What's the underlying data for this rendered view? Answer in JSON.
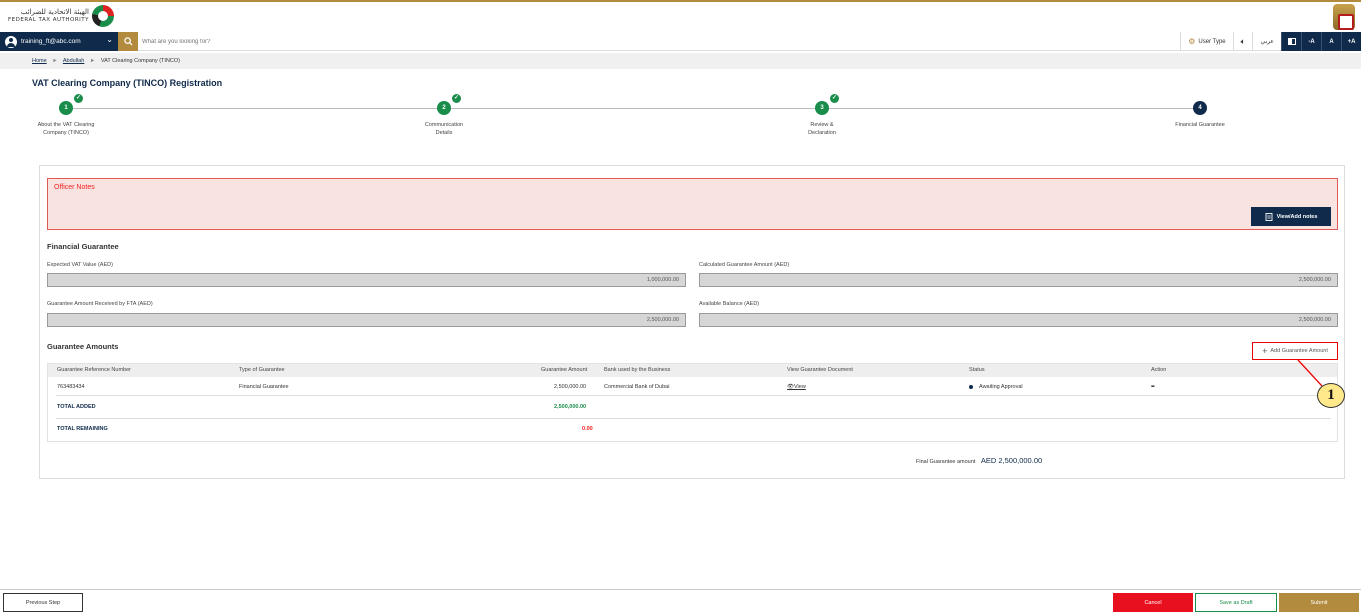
{
  "header": {
    "logo_ar": "الهيئة الاتحادية للضرائب",
    "logo_en": "FEDERAL TAX AUTHORITY"
  },
  "navbar": {
    "user_email": "training_ft@abc.com",
    "search_placeholder": "What are you looking for?",
    "user_type": "User Type",
    "language": "عربي",
    "font_minus": "-A",
    "font_normal": "A",
    "font_plus": "+A"
  },
  "breadcrumb": {
    "home": "Home",
    "sep1": "►",
    "abdullah": "Abdullah",
    "sep2": "►",
    "current": "VAT Clearing Company (TINCO)"
  },
  "page": {
    "title": "VAT Clearing Company (TINCO) Registration"
  },
  "steps": [
    {
      "number": "1",
      "label": "About the VAT Clearing Company (TINCO)",
      "status": "done"
    },
    {
      "number": "2",
      "label": "Communication Details",
      "status": "done"
    },
    {
      "number": "3",
      "label": "Review & Declaration",
      "status": "done"
    },
    {
      "number": "4",
      "label": "Financial Guarantee",
      "status": "current"
    }
  ],
  "officer_notes": {
    "title": "Officer Notes",
    "button": "View/Add notes"
  },
  "financial_guarantee": {
    "title": "Financial Guarantee",
    "expected_vat_label": "Expected VAT Value (AED)",
    "expected_vat_value": "1,000,000.00",
    "calculated_label": "Calculated Guarantee Amount (AED)",
    "calculated_value": "2,500,000.00",
    "received_label": "Guarantee Amount Received by FTA (AED)",
    "received_value": "2,500,000.00",
    "available_label": "Available Balance (AED)",
    "available_value": "2,500,000.00"
  },
  "guarantee_amounts": {
    "title": "Guarantee Amounts",
    "add_button": "Add Guarantee Amount",
    "columns": {
      "ref": "Guarantee Reference Number",
      "type": "Type of Guarantee",
      "amount": "Guarantee Amount",
      "bank": "Bank used by the Business",
      "doc": "View Guarantee Document",
      "status": "Status",
      "action": "Action"
    },
    "rows": [
      {
        "ref": "763483434",
        "type": "Financial Guarantee",
        "amount": "2,500,000.00",
        "bank": "Commercial Bank of Dubai",
        "doc": "View",
        "status": "Awaiting Approval",
        "action": "•••"
      }
    ],
    "total_added_label": "TOTAL ADDED",
    "total_added_value": "2,500,000.00",
    "total_remaining_label": "TOTAL REMAINING",
    "total_remaining_value": "0.00",
    "final_label": "Final Guarantee amount",
    "final_value": "AED 2,500,000.00"
  },
  "annotation": "1",
  "footer": {
    "previous": "Previous Step",
    "cancel": "Cancel",
    "save_draft": "Save as Draft",
    "submit": "Submit"
  },
  "colors": {
    "navy": "#0f2a4a",
    "gold": "#b38b3f",
    "green": "#1a8d4b",
    "red": "#e8101e",
    "notes_bg": "#f9e3e1"
  }
}
